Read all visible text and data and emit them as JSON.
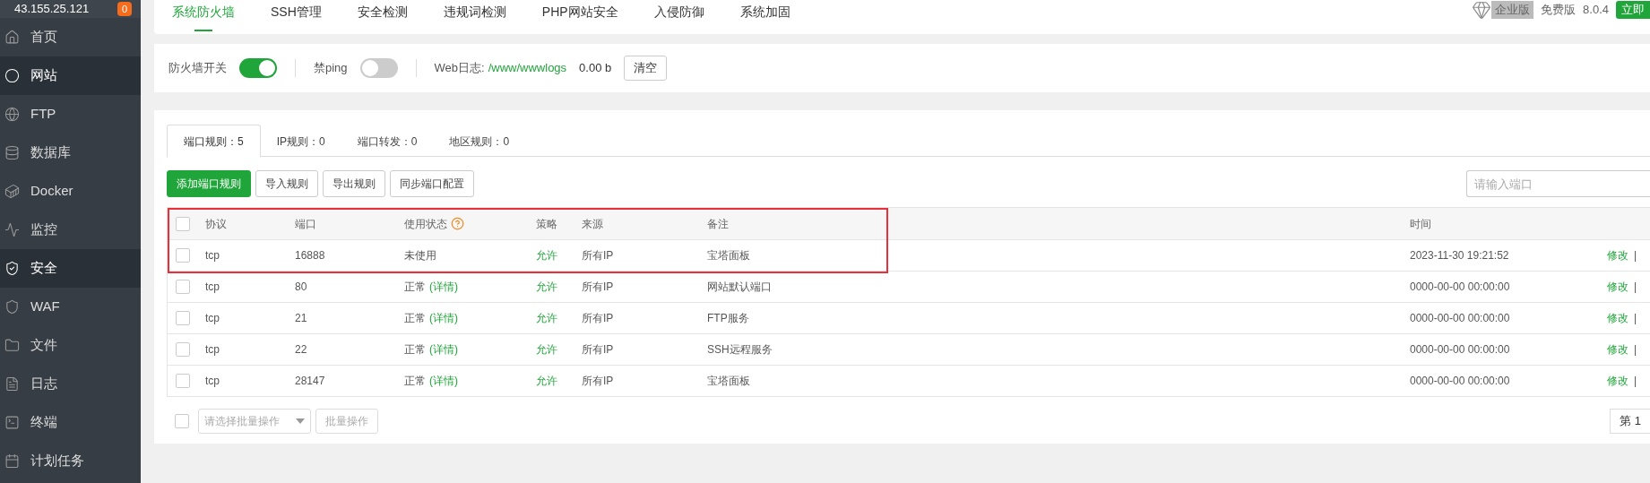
{
  "sidebar": {
    "server": "43.155.25.121",
    "badge": "0",
    "items": [
      {
        "label": "首页",
        "selected": false
      },
      {
        "label": "网站",
        "selected": true
      },
      {
        "label": "FTP",
        "selected": false
      },
      {
        "label": "数据库",
        "selected": false
      },
      {
        "label": "Docker",
        "selected": false
      },
      {
        "label": "监控",
        "selected": false
      },
      {
        "label": "安全",
        "selected": true
      },
      {
        "label": "WAF",
        "selected": false
      },
      {
        "label": "文件",
        "selected": false
      },
      {
        "label": "日志",
        "selected": false
      },
      {
        "label": "终端",
        "selected": false
      },
      {
        "label": "计划任务",
        "selected": false
      }
    ]
  },
  "top_tabs": [
    {
      "label": "系统防火墙",
      "selected": true
    },
    {
      "label": "SSH管理",
      "selected": false
    },
    {
      "label": "安全检测",
      "selected": false
    },
    {
      "label": "违规词检测",
      "selected": false
    },
    {
      "label": "PHP网站安全",
      "selected": false
    },
    {
      "label": "入侵防御",
      "selected": false
    },
    {
      "label": "系统加固",
      "selected": false
    }
  ],
  "edition": {
    "enterprise": "企业版",
    "free": "免费版",
    "version": "8.0.4",
    "upgrade": "立即"
  },
  "firewall": {
    "switch_label": "防火墙开关",
    "switch_on": true,
    "ping_label": "禁ping",
    "ping_on": false,
    "log_label": "Web日志:",
    "log_path": "/www/wwwlogs",
    "log_size": "0.00 b",
    "clear": "清空"
  },
  "rule_tabs": [
    {
      "label": "端口规则：5",
      "selected": true
    },
    {
      "label": "IP规则：0",
      "selected": false
    },
    {
      "label": "端口转发：0",
      "selected": false
    },
    {
      "label": "地区规则：0",
      "selected": false
    }
  ],
  "actions": [
    {
      "label": "添加端口规则",
      "primary": true
    },
    {
      "label": "导入规则",
      "primary": false
    },
    {
      "label": "导出规则",
      "primary": false
    },
    {
      "label": "同步端口配置",
      "primary": false
    }
  ],
  "search": {
    "placeholder": "请输入端口"
  },
  "table": {
    "columns": [
      "协议",
      "端口",
      "使用状态",
      "策略",
      "来源",
      "备注",
      "时间"
    ],
    "header_checked": false,
    "annotation_box": true,
    "rows": [
      {
        "checked": false,
        "protocol": "tcp",
        "port": "16888",
        "status": "未使用",
        "policy": "允许",
        "source": "所有IP",
        "remark": "宝塔面板",
        "time": "2023-11-30 19:21:52",
        "edit": "修改",
        "sep": "|"
      },
      {
        "checked": false,
        "protocol": "tcp",
        "port": "80",
        "status": "正常",
        "status_link": "(详情)",
        "policy": "允许",
        "source": "所有IP",
        "remark": "网站默认端口",
        "time": "0000-00-00 00:00:00",
        "edit": "修改",
        "sep": "|"
      },
      {
        "checked": false,
        "protocol": "tcp",
        "port": "21",
        "status": "正常",
        "status_link": "(详情)",
        "policy": "允许",
        "source": "所有IP",
        "remark": "FTP服务",
        "time": "0000-00-00 00:00:00",
        "edit": "修改",
        "sep": "|"
      },
      {
        "checked": false,
        "protocol": "tcp",
        "port": "22",
        "status": "正常",
        "status_link": "(详情)",
        "policy": "允许",
        "source": "所有IP",
        "remark": "SSH远程服务",
        "time": "0000-00-00 00:00:00",
        "edit": "修改",
        "sep": "|"
      },
      {
        "checked": false,
        "protocol": "tcp",
        "port": "28147",
        "status": "正常",
        "status_link": "(详情)",
        "policy": "允许",
        "source": "所有IP",
        "remark": "宝塔面板",
        "time": "0000-00-00 00:00:00",
        "edit": "修改",
        "sep": "|"
      }
    ]
  },
  "batch": {
    "checked": false,
    "placeholder": "请选择批量操作",
    "button": "批量操作",
    "button_disabled": true
  },
  "pagination": {
    "page": "第 1"
  }
}
